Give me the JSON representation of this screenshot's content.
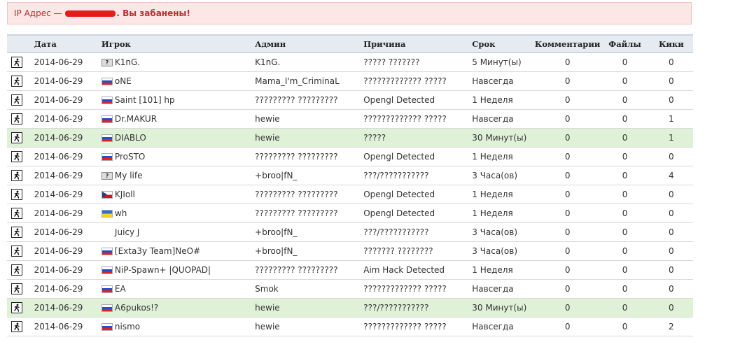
{
  "alert": {
    "prefix": "IP Адрес — ",
    "suffix": ". Вы забанены!"
  },
  "table": {
    "headers": {
      "date": "Дата",
      "player": "Игрок",
      "admin": "Админ",
      "reason": "Причина",
      "term": "Срок",
      "comments": "Комментарии",
      "files": "Файлы",
      "kicks": "Кики"
    },
    "rows": [
      {
        "date": "2014-06-29",
        "flag": "unknown",
        "player": "K1nG.",
        "admin": "K1nG.",
        "reason": "????? ???????",
        "term": "5 Минут(ы)",
        "comments": "0",
        "files": "0",
        "kicks": "0",
        "highlight": false
      },
      {
        "date": "2014-06-29",
        "flag": "ru",
        "player": "oNE",
        "admin": "Mama_I'm_CriminaL",
        "reason": "????????????? ?????",
        "term": "Навсегда",
        "comments": "0",
        "files": "0",
        "kicks": "0",
        "highlight": false
      },
      {
        "date": "2014-06-29",
        "flag": "ru",
        "player": "Saint [101] hp",
        "admin": "????????? ?????????",
        "reason": "Opengl Detected",
        "term": "1 Неделя",
        "comments": "0",
        "files": "0",
        "kicks": "0",
        "highlight": false
      },
      {
        "date": "2014-06-29",
        "flag": "ru",
        "player": "Dr.MAKUR",
        "admin": "hewie",
        "reason": "????????????? ?????",
        "term": "Навсегда",
        "comments": "0",
        "files": "0",
        "kicks": "1",
        "highlight": false
      },
      {
        "date": "2014-06-29",
        "flag": "ru",
        "player": "DIABLO",
        "admin": "hewie",
        "reason": "?????",
        "term": "30 Минут(ы)",
        "comments": "0",
        "files": "0",
        "kicks": "1",
        "highlight": true
      },
      {
        "date": "2014-06-29",
        "flag": "ru",
        "player": "ProSTO",
        "admin": "????????? ?????????",
        "reason": "Opengl Detected",
        "term": "1 Неделя",
        "comments": "0",
        "files": "0",
        "kicks": "0",
        "highlight": false
      },
      {
        "date": "2014-06-29",
        "flag": "unknown",
        "player": "My life",
        "admin": "+broo|fN_",
        "reason": "???/???????????",
        "term": "3 Часа(ов)",
        "comments": "0",
        "files": "0",
        "kicks": "4",
        "highlight": false
      },
      {
        "date": "2014-06-29",
        "flag": "cz",
        "player": "KJIoll",
        "admin": "????????? ?????????",
        "reason": "Opengl Detected",
        "term": "1 Неделя",
        "comments": "0",
        "files": "0",
        "kicks": "0",
        "highlight": false
      },
      {
        "date": "2014-06-29",
        "flag": "ua",
        "player": "wh",
        "admin": "????????? ?????????",
        "reason": "Opengl Detected",
        "term": "1 Неделя",
        "comments": "0",
        "files": "0",
        "kicks": "0",
        "highlight": false
      },
      {
        "date": "2014-06-29",
        "flag": "none",
        "player": "Juicy J",
        "admin": "+broo|fN_",
        "reason": "???/???????????",
        "term": "3 Часа(ов)",
        "comments": "0",
        "files": "0",
        "kicks": "0",
        "highlight": false
      },
      {
        "date": "2014-06-29",
        "flag": "ru",
        "player": "[Exta3y Team]NeO#",
        "admin": "+broo|fN_",
        "reason": "??????? ????????",
        "term": "3 Часа(ов)",
        "comments": "0",
        "files": "0",
        "kicks": "0",
        "highlight": false
      },
      {
        "date": "2014-06-29",
        "flag": "ru",
        "player": "NiP-Spawn+ |QUOPAD|",
        "admin": "????????? ?????????",
        "reason": "Aim Hack Detected",
        "term": "1 Неделя",
        "comments": "0",
        "files": "0",
        "kicks": "0",
        "highlight": false
      },
      {
        "date": "2014-06-29",
        "flag": "ru",
        "player": "EA",
        "admin": "Smok",
        "reason": "????????????? ?????",
        "term": "Навсегда",
        "comments": "0",
        "files": "0",
        "kicks": "0",
        "highlight": false
      },
      {
        "date": "2014-06-29",
        "flag": "ru",
        "player": "А6pukos!?",
        "admin": "hewie",
        "reason": "???/???????????",
        "term": "30 Минут(ы)",
        "comments": "0",
        "files": "0",
        "kicks": "0",
        "highlight": true
      },
      {
        "date": "2014-06-29",
        "flag": "ru",
        "player": "nismo",
        "admin": "hewie",
        "reason": "????????????? ?????",
        "term": "Навсегда",
        "comments": "0",
        "files": "0",
        "kicks": "2",
        "highlight": false
      }
    ]
  },
  "colors": {
    "alert_bg": "#fde6e6",
    "alert_text": "#b23131",
    "highlight_row": "#dff2d8",
    "header_bg": "#e6ebf2"
  }
}
